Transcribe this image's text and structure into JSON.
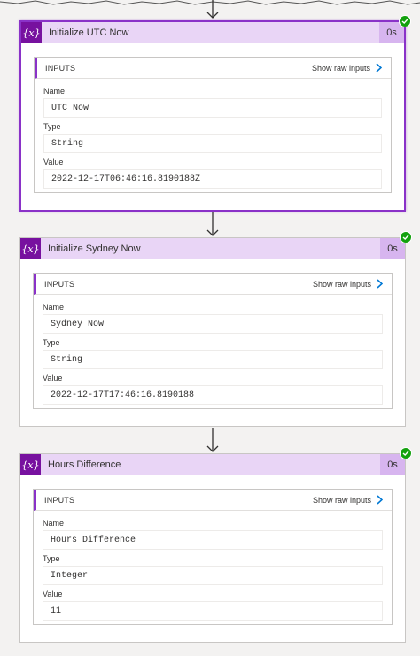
{
  "cards": [
    {
      "title": "Initialize UTC Now",
      "duration": "0s",
      "icon": "variable-icon",
      "icon_text": "{x}",
      "inputs_label": "INPUTS",
      "raw_link": "Show raw inputs",
      "fields": [
        {
          "label": "Name",
          "value": "UTC Now"
        },
        {
          "label": "Type",
          "value": "String"
        },
        {
          "label": "Value",
          "value": "2022-12-17T06:46:16.8190188Z"
        }
      ]
    },
    {
      "title": "Initialize Sydney Now",
      "duration": "0s",
      "icon": "variable-icon",
      "icon_text": "{x}",
      "inputs_label": "INPUTS",
      "raw_link": "Show raw inputs",
      "fields": [
        {
          "label": "Name",
          "value": "Sydney Now"
        },
        {
          "label": "Type",
          "value": "String"
        },
        {
          "label": "Value",
          "value": "2022-12-17T17:46:16.8190188"
        }
      ]
    },
    {
      "title": "Hours Difference",
      "duration": "0s",
      "icon": "variable-icon",
      "icon_text": "{x}",
      "inputs_label": "INPUTS",
      "raw_link": "Show raw inputs",
      "fields": [
        {
          "label": "Name",
          "value": "Hours Difference"
        },
        {
          "label": "Type",
          "value": "Integer"
        },
        {
          "label": "Value",
          "value": "11"
        }
      ]
    }
  ],
  "colors": {
    "accent": "#8a32c8",
    "header_bg": "#e9d5f6",
    "icon_bg": "#77119f",
    "success": "#13a10e"
  }
}
